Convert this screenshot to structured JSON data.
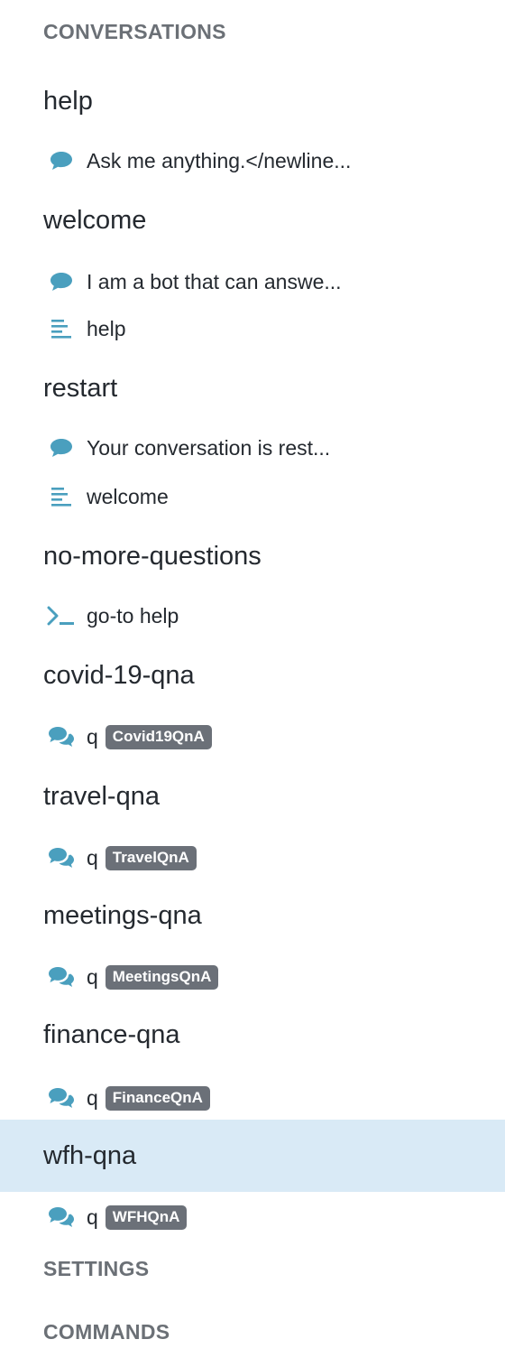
{
  "colors": {
    "icon": "#4a9fbe",
    "header_text": "#6b7076",
    "badge_bg": "#6b7078",
    "selected_bg": "#d9eaf6"
  },
  "sections": {
    "conversations": "CONVERSATIONS",
    "settings": "SETTINGS",
    "commands": "COMMANDS"
  },
  "topics": [
    {
      "name": "help",
      "steps": [
        {
          "icon": "speech-bubble-icon",
          "text": "Ask me anything.</newline..."
        }
      ]
    },
    {
      "name": "welcome",
      "steps": [
        {
          "icon": "speech-bubble-icon",
          "text": "I am a bot that can answe..."
        },
        {
          "icon": "text-lines-icon",
          "text": "help"
        }
      ]
    },
    {
      "name": "restart",
      "steps": [
        {
          "icon": "speech-bubble-icon",
          "text": "Your conversation is rest..."
        },
        {
          "icon": "text-lines-icon",
          "text": "welcome"
        }
      ]
    },
    {
      "name": "no-more-questions",
      "steps": [
        {
          "icon": "terminal-icon",
          "text": "go-to help"
        }
      ]
    },
    {
      "name": "covid-19-qna",
      "steps": [
        {
          "icon": "chat-bubbles-icon",
          "text": "q",
          "badge": "Covid19QnA"
        }
      ]
    },
    {
      "name": "travel-qna",
      "steps": [
        {
          "icon": "chat-bubbles-icon",
          "text": "q",
          "badge": "TravelQnA"
        }
      ]
    },
    {
      "name": "meetings-qna",
      "steps": [
        {
          "icon": "chat-bubbles-icon",
          "text": "q",
          "badge": "MeetingsQnA"
        }
      ]
    },
    {
      "name": "finance-qna",
      "steps": [
        {
          "icon": "chat-bubbles-icon",
          "text": "q",
          "badge": "FinanceQnA"
        }
      ]
    },
    {
      "name": "wfh-qna",
      "selected": true,
      "steps": [
        {
          "icon": "chat-bubbles-icon",
          "text": "q",
          "badge": "WFHQnA"
        }
      ]
    }
  ]
}
